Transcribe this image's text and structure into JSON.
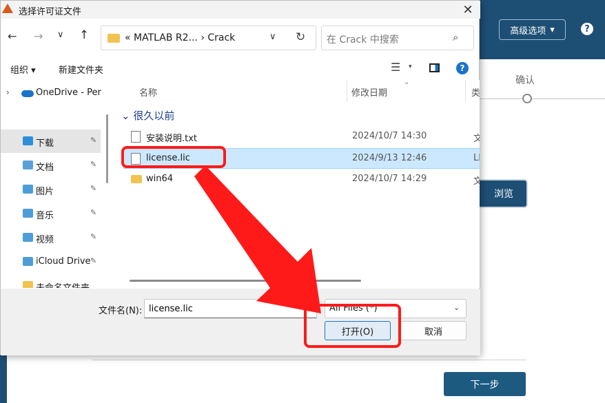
{
  "background_app": {
    "advanced_label": "高级选项",
    "help_glyph": "?",
    "step_label": "确认",
    "browse_label": "浏览",
    "next_label": "下一步",
    "header_color": "#1d4e74"
  },
  "dialog": {
    "title": "选择许可证文件",
    "close_glyph": "✕",
    "nav": {
      "back": "←",
      "forward": "→",
      "recent": "∨",
      "up": "↑"
    },
    "address": {
      "path": "« MATLAB R2... › Crack",
      "chevron": "∨",
      "refresh": "↻"
    },
    "search": {
      "placeholder": "在 Crack 中搜索",
      "icon": "⌕"
    },
    "toolbar": {
      "organize": "组织 ▾",
      "new_folder": "新建文件夹",
      "view_icon": "☰",
      "view_arrow": "▾",
      "help": "?"
    },
    "nav_pane": {
      "expand_glyph": "›",
      "items": [
        {
          "label": "OneDrive - Per",
          "pinned": false
        },
        {
          "label": "下载",
          "pinned": true
        },
        {
          "label": "文档",
          "pinned": true
        },
        {
          "label": "图片",
          "pinned": true
        },
        {
          "label": "音乐",
          "pinned": true
        },
        {
          "label": "视频",
          "pinned": true
        },
        {
          "label": "iCloud Drive",
          "pinned": true
        },
        {
          "label": "未命名文件夹",
          "pinned": true
        }
      ],
      "pin_glyph": "📌"
    },
    "columns": {
      "name": "名称",
      "date": "修改日期",
      "type": "类"
    },
    "group_header": "很久以前",
    "files": [
      {
        "name": "安装说明.txt",
        "date": "2024/10/7 14:30",
        "type": "文"
      },
      {
        "name": "license.lic",
        "date": "2024/9/13 12:46",
        "type": "LI"
      },
      {
        "name": "win64",
        "date": "2024/10/7 14:29",
        "type": "文"
      }
    ],
    "filename_label": "文件名(N):",
    "filename_value": "license.lic",
    "filetype_value": "All Files (*)",
    "open_label": "打开(O)",
    "cancel_label": "取消"
  },
  "annotation_color": "#ff1a1a"
}
